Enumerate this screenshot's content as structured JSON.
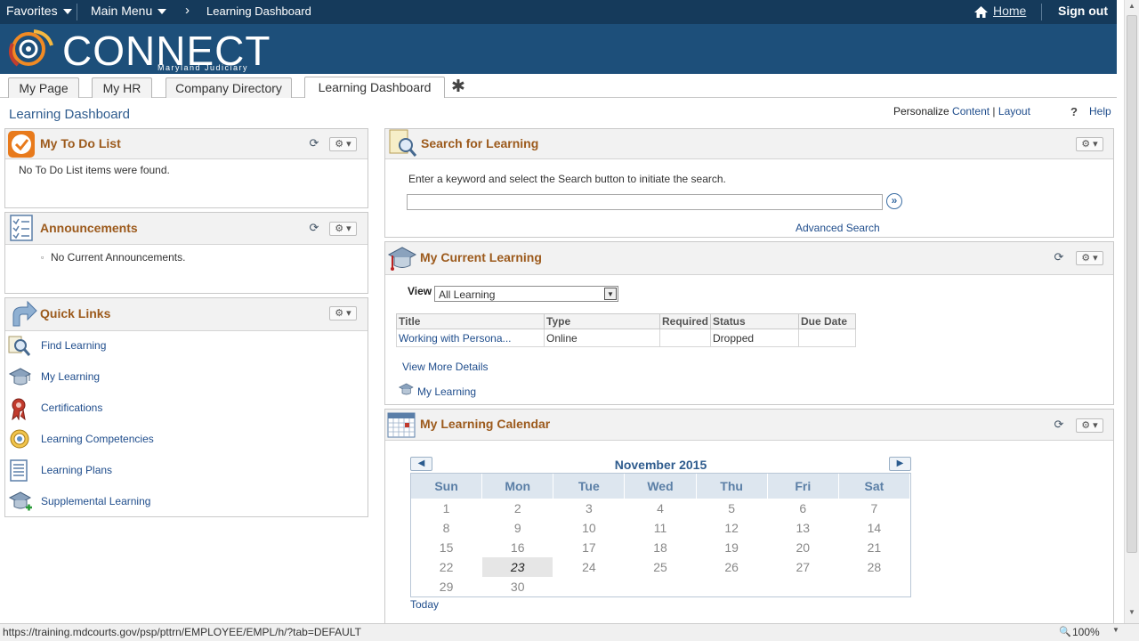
{
  "topbar": {
    "favorites": "Favorites",
    "main_menu": "Main Menu",
    "breadcrumb_sep": "›",
    "breadcrumb": "Learning Dashboard",
    "home": "Home",
    "sign_out": "Sign out"
  },
  "banner": {
    "logo": "CONNECT",
    "logo_sub": "Maryland Judiciary"
  },
  "tabs": [
    {
      "label": "My Page"
    },
    {
      "label": "My HR"
    },
    {
      "label": "Company Directory"
    },
    {
      "label": "Learning Dashboard",
      "active": true
    }
  ],
  "page": {
    "title": "Learning Dashboard",
    "personalize": "Personalize",
    "content": "Content",
    "sep": "|",
    "layout": "Layout",
    "help_q": "?",
    "help": "Help"
  },
  "todo": {
    "title": "My To Do List",
    "empty": "No To Do List items were found."
  },
  "announcements": {
    "title": "Announcements",
    "bullet": "▫",
    "item": "No Current Announcements."
  },
  "quicklinks": {
    "title": "Quick Links",
    "items": [
      {
        "label": "Find Learning",
        "icon": "magnifier-icon"
      },
      {
        "label": "My Learning",
        "icon": "graduation-cap-icon"
      },
      {
        "label": "Certifications",
        "icon": "ribbon-award-icon"
      },
      {
        "label": "Learning Competencies",
        "icon": "target-icon"
      },
      {
        "label": "Learning Plans",
        "icon": "checklist-icon"
      },
      {
        "label": "Supplemental Learning",
        "icon": "cap-plus-icon"
      }
    ]
  },
  "search": {
    "title": "Search for Learning",
    "instructions": "Enter a keyword and select the Search button to initiate the search.",
    "input_value": "",
    "advanced": "Advanced Search"
  },
  "current": {
    "title": "My Current Learning",
    "view_label": "View",
    "view_value": "All Learning",
    "columns": [
      "Title",
      "Type",
      "Required",
      "Status",
      "Due Date"
    ],
    "rows": [
      [
        "Working with Persona...",
        "Online",
        "",
        "Dropped",
        ""
      ]
    ],
    "more": "View More Details",
    "my_learning": "My Learning"
  },
  "calendar": {
    "title": "My Learning Calendar",
    "month": "November 2015",
    "days": [
      "Sun",
      "Mon",
      "Tue",
      "Wed",
      "Thu",
      "Fri",
      "Sat"
    ],
    "weeks": [
      [
        "1",
        "2",
        "3",
        "4",
        "5",
        "6",
        "7"
      ],
      [
        "8",
        "9",
        "10",
        "11",
        "12",
        "13",
        "14"
      ],
      [
        "15",
        "16",
        "17",
        "18",
        "19",
        "20",
        "21"
      ],
      [
        "22",
        "23",
        "24",
        "25",
        "26",
        "27",
        "28"
      ],
      [
        "29",
        "30",
        "",
        "",
        "",
        "",
        ""
      ]
    ],
    "today_date": "23",
    "today_link": "Today"
  },
  "status": {
    "url": "https://training.mdcourts.gov/psp/pttrn/EMPLOYEE/EMPL/h/?tab=DEFAULT",
    "zoom": "100%"
  },
  "colors": {
    "topbar": "#153a5b",
    "banner": "#1d4f7a",
    "pane_title": "#9c5a1c",
    "link": "#1f4d8c"
  }
}
